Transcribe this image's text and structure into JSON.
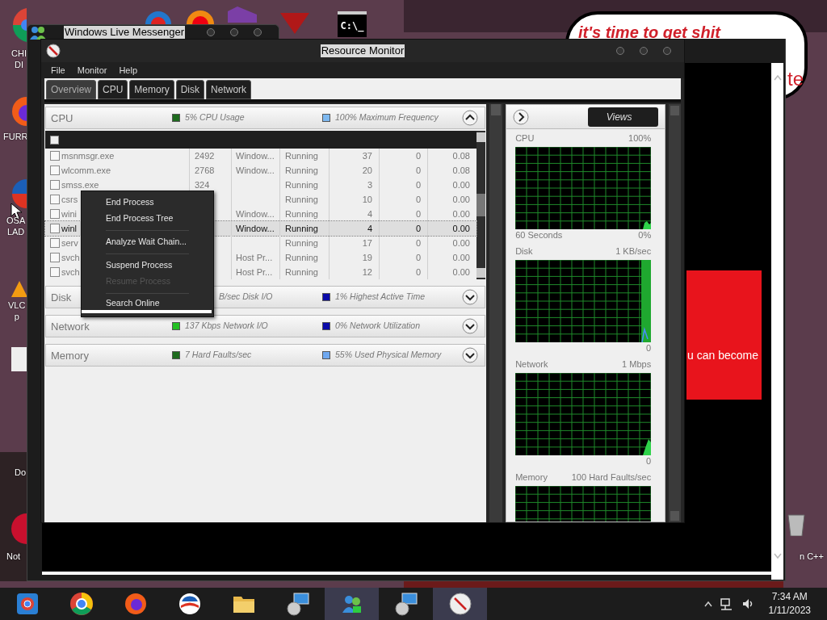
{
  "desktop": {
    "icons": [
      {
        "lines": [
          "CHI",
          "DI"
        ]
      },
      {
        "lines": [
          "FURR"
        ]
      },
      {
        "lines": [
          "OSA",
          "LAD"
        ]
      },
      {
        "lines": [
          "VLC",
          "p"
        ]
      },
      {
        "lines": [
          "Do"
        ]
      },
      {
        "lines": [
          "Not"
        ]
      },
      {
        "lines": [
          "n C++"
        ]
      }
    ],
    "console_icon_text": "C:\\_",
    "speech_bubble": {
      "line_1": "it's time to get shit",
      "line_2": "te"
    }
  },
  "background_window": {
    "title": "Windows Live Messenger",
    "ad_text": "u can become"
  },
  "resource_monitor": {
    "title": "Resource Monitor",
    "menu": [
      "File",
      "Monitor",
      "Help"
    ],
    "tabs": [
      {
        "label": "Overview",
        "selected": true
      },
      {
        "label": "CPU",
        "selected": false
      },
      {
        "label": "Memory",
        "selected": false
      },
      {
        "label": "Disk",
        "selected": false
      },
      {
        "label": "Network",
        "selected": false
      }
    ],
    "sections": [
      {
        "title": "CPU",
        "expanded": true,
        "stats": [
          {
            "text": "5% CPU Usage",
            "color": "#1e6b1e"
          },
          {
            "text": "100% Maximum Frequency",
            "color": "#7db8f0"
          }
        ],
        "table": {
          "header_checked": false,
          "rows": [
            {
              "image": "msnmsgr.exe",
              "pid": "2492",
              "description": "Window...",
              "status": "Running",
              "threads": "37",
              "cpu": "0",
              "average_cpu": "0.08",
              "checked": false,
              "selected": false
            },
            {
              "image": "wlcomm.exe",
              "pid": "2768",
              "description": "Window...",
              "status": "Running",
              "threads": "20",
              "cpu": "0",
              "average_cpu": "0.08",
              "checked": false,
              "selected": false
            },
            {
              "image": "smss.exe",
              "pid": "324",
              "status": "Running",
              "threads": "3",
              "cpu": "0",
              "average_cpu": "0.00",
              "checked": false,
              "selected": false
            },
            {
              "image": "csrs",
              "status": "Running",
              "threads": "10",
              "cpu": "0",
              "average_cpu": "0.00",
              "checked": false,
              "selected": false
            },
            {
              "image": "wini",
              "description": "Window...",
              "status": "Running",
              "threads": "4",
              "cpu": "0",
              "average_cpu": "0.00",
              "checked": false,
              "selected": false
            },
            {
              "image": "winl",
              "description": "Window...",
              "status": "Running",
              "threads": "4",
              "cpu": "0",
              "average_cpu": "0.00",
              "checked": false,
              "selected": true
            },
            {
              "image": "serv",
              "status": "Running",
              "threads": "17",
              "cpu": "0",
              "average_cpu": "0.00",
              "checked": false,
              "selected": false
            },
            {
              "image": "svch",
              "description": "Host Pr...",
              "status": "Running",
              "threads": "19",
              "cpu": "0",
              "average_cpu": "0.00",
              "checked": false,
              "selected": false
            },
            {
              "image": "svch",
              "description": "Host Pr...",
              "status": "Running",
              "threads": "12",
              "cpu": "0",
              "average_cpu": "0.00",
              "checked": false,
              "selected": false
            }
          ]
        }
      },
      {
        "title": "Disk",
        "expanded": false,
        "stats": [
          {
            "text": "B/sec Disk I/O"
          },
          {
            "text": "1% Highest Active Time",
            "color": "#0a0aa8"
          }
        ]
      },
      {
        "title": "Network",
        "expanded": false,
        "stats": [
          {
            "text": "137 Kbps Network I/O",
            "color": "#22c022"
          },
          {
            "text": "0% Network Utilization",
            "color": "#0a0aa8"
          }
        ]
      },
      {
        "title": "Memory",
        "expanded": false,
        "stats": [
          {
            "text": "7 Hard Faults/sec",
            "color": "#1e6b1e"
          },
          {
            "text": "55% Used Physical Memory",
            "color": "#6fa8f0"
          }
        ]
      }
    ],
    "context_menu": [
      {
        "kind": "item",
        "label": "End Process",
        "disabled": false,
        "highlighted": false
      },
      {
        "kind": "item",
        "label": "End Process Tree",
        "disabled": false,
        "highlighted": false
      },
      {
        "kind": "separator"
      },
      {
        "kind": "item",
        "label": "Analyze Wait Chain...",
        "disabled": false,
        "highlighted": false
      },
      {
        "kind": "separator"
      },
      {
        "kind": "item",
        "label": "Suspend Process",
        "disabled": false,
        "highlighted": false
      },
      {
        "kind": "item",
        "label": "Resume Process",
        "disabled": true,
        "highlighted": false
      },
      {
        "kind": "separator"
      },
      {
        "kind": "item",
        "label": "Search Online",
        "disabled": false,
        "highlighted": true
      }
    ],
    "views_label": "Views",
    "graphs": [
      {
        "title": "CPU",
        "max": "100%",
        "footer_left": "60 Seconds",
        "min": "0%"
      },
      {
        "title": "Disk",
        "max": "1 KB/sec",
        "min": "0"
      },
      {
        "title": "Network",
        "max": "1 Mbps",
        "min": "0"
      },
      {
        "title": "Memory",
        "max": "100 Hard Faults/sec"
      }
    ]
  },
  "taskbar": {
    "time": "7:34 AM",
    "date": "1/11/2023"
  }
}
